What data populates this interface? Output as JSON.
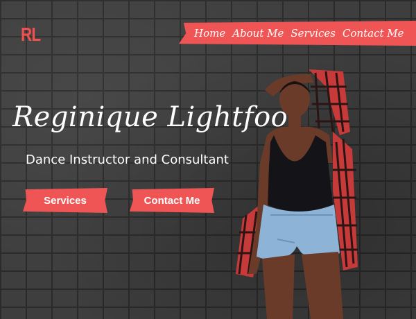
{
  "logo": {
    "text": "RL"
  },
  "nav": {
    "items": [
      {
        "label": "Home"
      },
      {
        "label": "About Me"
      },
      {
        "label": "Services"
      },
      {
        "label": "Contact Me"
      }
    ]
  },
  "hero": {
    "name": "Reginique Lightfoot",
    "tagline": "Dance Instructor and Consultant",
    "buttons": {
      "services": "Services",
      "contact": "Contact Me"
    }
  },
  "colors": {
    "accent": "#f05555",
    "background": "#3e3e3e",
    "text": "#ffffff"
  }
}
